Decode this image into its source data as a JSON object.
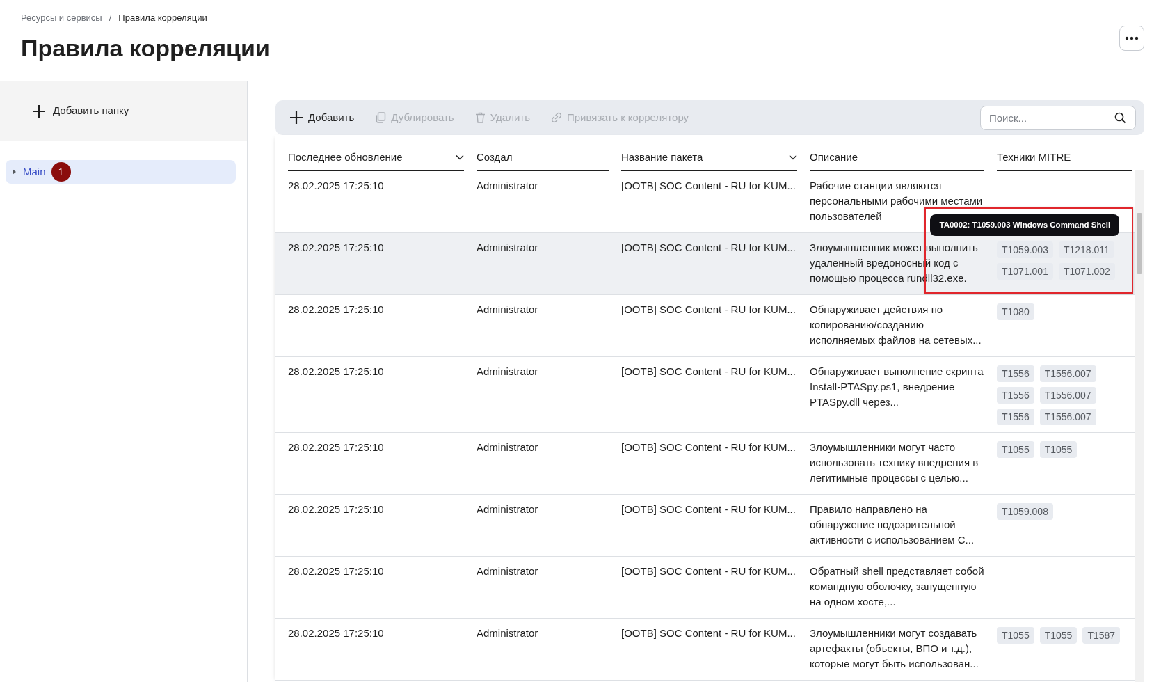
{
  "breadcrumbs": [
    {
      "label": "Ресурсы и сервисы",
      "current": false
    },
    {
      "label": "Правила корреляции",
      "current": true
    }
  ],
  "breadcrumb_separator": "/",
  "title": "Правила корреляции",
  "sidebar": {
    "add_folder": "Добавить папку",
    "folders": [
      {
        "label": "Main",
        "selected": true,
        "expanded": false,
        "marker": "1"
      }
    ]
  },
  "toolbar": {
    "buttons": [
      {
        "label": "Добавить",
        "kind": "add",
        "disabled": false
      },
      {
        "label": "Дублировать",
        "kind": "duplicate",
        "disabled": true
      },
      {
        "label": "Удалить",
        "kind": "delete",
        "disabled": true
      },
      {
        "label": "Привязать к коррелятору",
        "kind": "link",
        "disabled": true
      }
    ],
    "search": {
      "placeholder": "Поиск..."
    }
  },
  "table": {
    "columns": [
      {
        "label": "Последнее обновление",
        "sortable": true
      },
      {
        "label": "Создал",
        "sortable": false
      },
      {
        "label": "Название пакета",
        "sortable": true
      },
      {
        "label": "Описание",
        "sortable": false
      },
      {
        "label": "Техники MITRE",
        "sortable": false
      }
    ],
    "rows": [
      {
        "updated": "28.02.2025 17:25:10",
        "author": "Administrator",
        "package": "[OOTB] SOC Content - RU for KUM...",
        "description": "Рабочие станции являются персональными рабочими местами пользователей",
        "techniques": [],
        "hovered": false,
        "highlighted": false
      },
      {
        "updated": "28.02.2025 17:25:10",
        "author": "Administrator",
        "package": "[OOTB] SOC Content - RU for KUM...",
        "description": "Злоумышленник может выполнить удаленный вредоносный код с помощью процесса rundll32.exe.",
        "techniques": [
          {
            "label": "T1059.003",
            "tooltip": "TA0002: T1059.003 Windows Command Shell"
          },
          {
            "label": "T1218.011"
          },
          {
            "label": "T1071.001"
          },
          {
            "label": "T1071.002"
          }
        ],
        "hovered": true,
        "highlighted": true
      },
      {
        "updated": "28.02.2025 17:25:10",
        "author": "Administrator",
        "package": "[OOTB] SOC Content - RU for KUM...",
        "description": "Обнаруживает действия по копированию/созданию исполняемых файлов на сетевых...",
        "techniques": [
          {
            "label": "T1080"
          }
        ],
        "hovered": false,
        "highlighted": false
      },
      {
        "updated": "28.02.2025 17:25:10",
        "author": "Administrator",
        "package": "[OOTB] SOC Content - RU for KUM...",
        "description": "Обнаруживает выполнение скрипта Install-PTASpy.ps1, внедрение PTASpy.dll через...",
        "techniques": [
          {
            "label": "T1556"
          },
          {
            "label": "T1556.007"
          },
          {
            "label": "T1556"
          },
          {
            "label": "T1556.007"
          },
          {
            "label": "T1556"
          },
          {
            "label": "T1556.007"
          }
        ],
        "hovered": false,
        "highlighted": false
      },
      {
        "updated": "28.02.2025 17:25:10",
        "author": "Administrator",
        "package": "[OOTB] SOC Content - RU for KUM...",
        "description": "Злоумышленники могут часто использовать технику внедрения в легитимные процессы с целью...",
        "techniques": [
          {
            "label": "T1055"
          },
          {
            "label": "T1055"
          }
        ],
        "hovered": false,
        "highlighted": false
      },
      {
        "updated": "28.02.2025 17:25:10",
        "author": "Administrator",
        "package": "[OOTB] SOC Content - RU for KUM...",
        "description": "Правило направлено на обнаружение подозрительной активности с использованием С...",
        "techniques": [
          {
            "label": "T1059.008"
          }
        ],
        "hovered": false,
        "highlighted": false
      },
      {
        "updated": "28.02.2025 17:25:10",
        "author": "Administrator",
        "package": "[OOTB] SOC Content - RU for KUM...",
        "description": "Обратный shell представляет собой командную оболочку, запущенную на одном хосте,...",
        "techniques": [],
        "hovered": false,
        "highlighted": false
      },
      {
        "updated": "28.02.2025 17:25:10",
        "author": "Administrator",
        "package": "[OOTB] SOC Content - RU for KUM...",
        "description": "Злоумышленники могут создавать артефакты (объекты, ВПО и т.д.), которые могут быть использован...",
        "techniques": [
          {
            "label": "T1055"
          },
          {
            "label": "T1055"
          },
          {
            "label": "T1587"
          }
        ],
        "hovered": false,
        "highlighted": false
      }
    ]
  }
}
